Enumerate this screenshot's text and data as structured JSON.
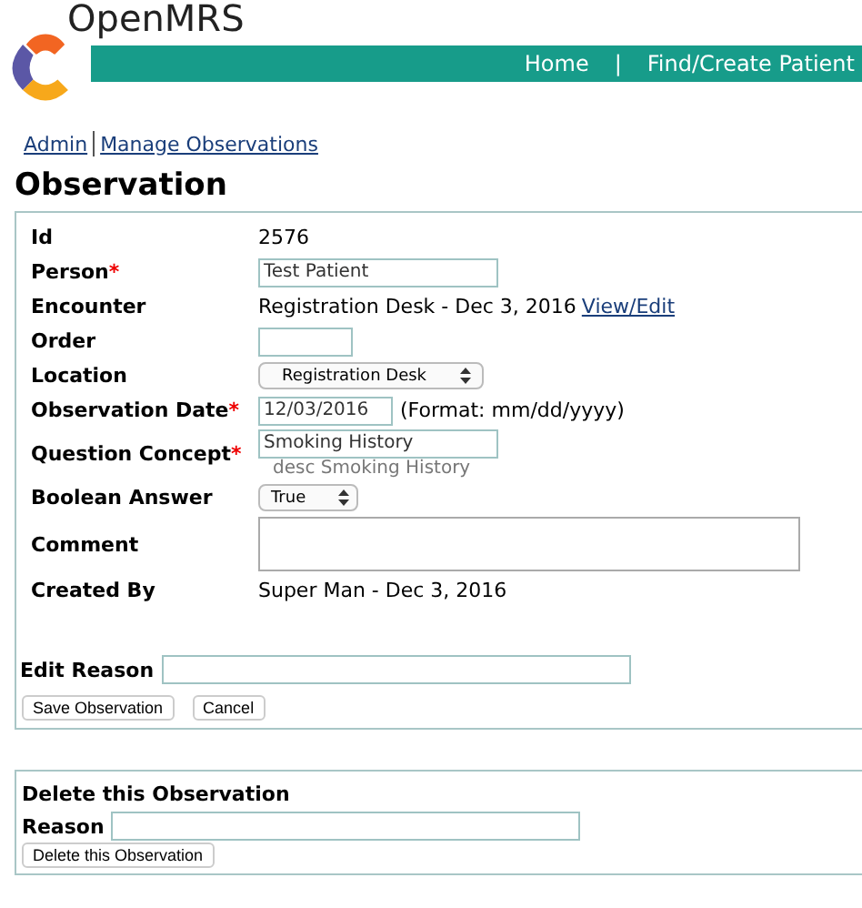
{
  "header": {
    "logo_text": "OpenMRS",
    "nav": [
      {
        "label": "Home"
      },
      {
        "label": "Find/Create Patient"
      }
    ],
    "separator": "|"
  },
  "breadcrumb": [
    {
      "label": "Admin"
    },
    {
      "label": "Manage Observations"
    }
  ],
  "title": "Observation",
  "fields": [
    {
      "label": "Id",
      "kind": "text",
      "value": "2576"
    },
    {
      "label": "Person",
      "kind": "input",
      "required_mark": "*",
      "value": "Test Patient"
    },
    {
      "label": "Encounter",
      "kind": "text",
      "value": "Registration Desk - Dec 3, 2016",
      "link": "View/Edit"
    },
    {
      "label": "Order",
      "kind": "input"
    },
    {
      "label": "Location",
      "kind": "select",
      "value": "Registration Desk"
    },
    {
      "label": "Observation Date",
      "kind": "input",
      "required_mark": "*",
      "value": "12/03/2016",
      "hint": "(Format: mm/dd/yyyy)"
    },
    {
      "label": "Question Concept",
      "kind": "input",
      "required_mark": "*",
      "value": "Smoking History",
      "description": "desc Smoking History"
    },
    {
      "label": "Boolean Answer",
      "kind": "select",
      "value": "True"
    },
    {
      "label": "Comment",
      "kind": "textarea"
    },
    {
      "label": "Created By",
      "kind": "text",
      "value": "Super Man - Dec 3, 2016"
    }
  ],
  "edit_reason": {
    "label": "Edit Reason"
  },
  "buttons": [
    "Save Observation",
    "Cancel"
  ],
  "delete_section": {
    "title": "Delete this Observation",
    "reason_label": "Reason",
    "button": "Delete this Observation"
  }
}
